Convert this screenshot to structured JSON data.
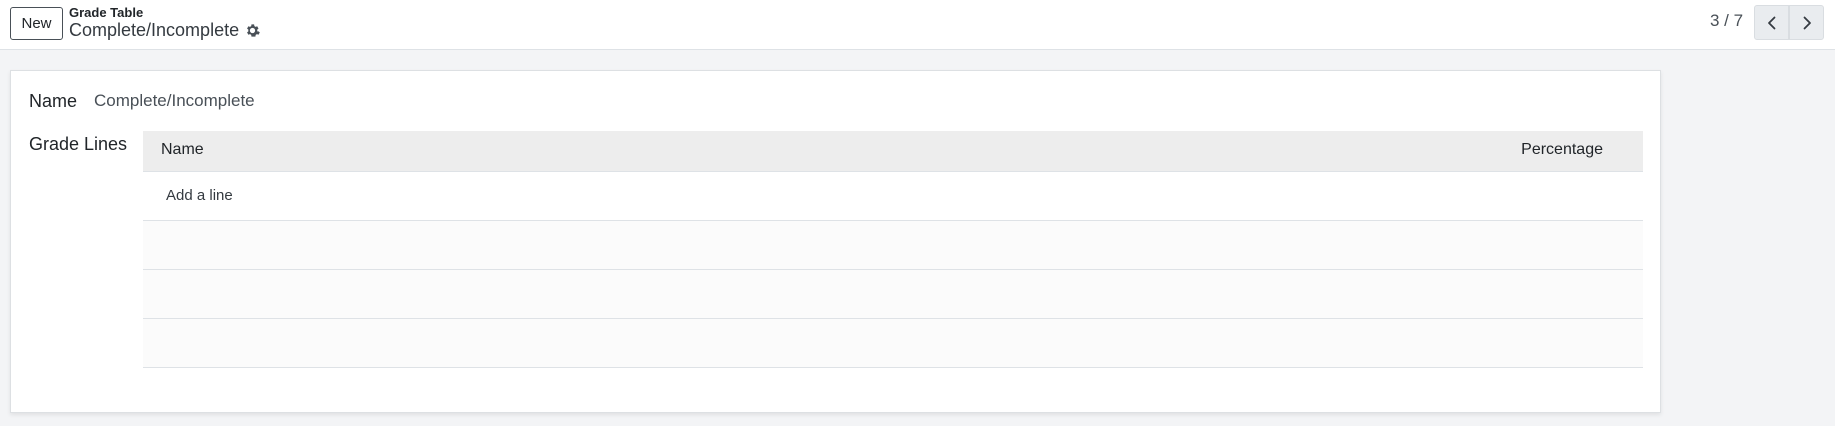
{
  "control_panel": {
    "new_label": "New",
    "breadcrumb_parent": "Grade Table",
    "breadcrumb_current": "Complete/Incomplete",
    "pager_value": "3 / 7"
  },
  "form": {
    "name_label": "Name",
    "name_value": "Complete/Incomplete",
    "grade_lines_label": "Grade Lines",
    "table": {
      "columns": [
        "Name",
        "Percentage"
      ],
      "add_line_label": "Add a line",
      "rows": []
    }
  },
  "icons": {
    "gear": "gear-icon",
    "prev": "chevron-left-icon",
    "next": "chevron-right-icon"
  },
  "colors": {
    "background": "#f3f4f6",
    "sheet": "#ffffff",
    "table_header": "#ededed",
    "pager_button": "#e9ecef"
  }
}
